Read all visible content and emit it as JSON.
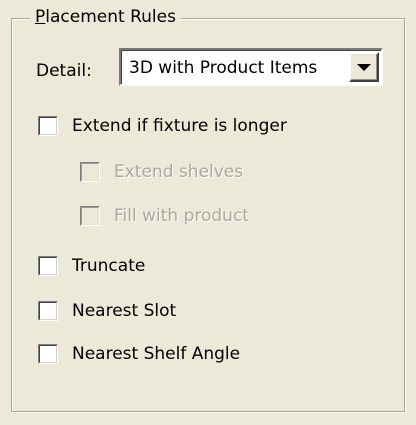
{
  "groupbox": {
    "title_mnemonic": "P",
    "title_rest": "lacement Rules"
  },
  "detail": {
    "label": "Detail:",
    "value": "3D with Product Items",
    "dropdown_icon": "chevron-down-icon"
  },
  "options": [
    {
      "label": "Extend if fixture is longer",
      "checked": false,
      "enabled": true
    },
    {
      "label": "Extend shelves",
      "checked": false,
      "enabled": false
    },
    {
      "label": "Fill with product",
      "checked": false,
      "enabled": false
    },
    {
      "label": "Truncate",
      "checked": false,
      "enabled": true
    },
    {
      "label": "Nearest Slot",
      "checked": false,
      "enabled": true
    },
    {
      "label": "Nearest Shelf Angle",
      "checked": false,
      "enabled": true
    }
  ]
}
